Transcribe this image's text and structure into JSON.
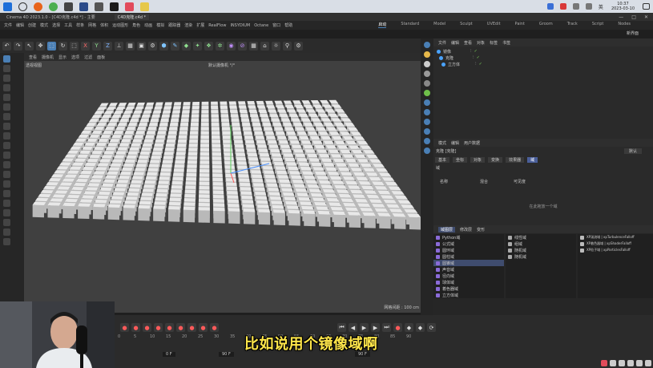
{
  "taskbar": {
    "search_icon": "search-icon",
    "clock_time": "10:37",
    "clock_date": "2023-03-10",
    "tray_lang": "英"
  },
  "window": {
    "title": "Cinema 4D 2023.1.0 - [C4D克隆.c4d *] - 主要",
    "doc_tab": "C4D克隆.c4d *",
    "menu": [
      "文件",
      "编辑",
      "创建",
      "模式",
      "选择",
      "工具",
      "样条",
      "网格",
      "体积",
      "运动图形",
      "角色",
      "动画",
      "模拟",
      "跟踪器",
      "渲染",
      "扩展",
      "RealFlow",
      "INSYDIUM",
      "Octane",
      "窗口",
      "帮助"
    ],
    "layouts": [
      "启动",
      "Standard",
      "Model",
      "Sculpt",
      "UVEdit",
      "Paint",
      "Groom",
      "Track",
      "Script",
      "Nodes"
    ],
    "layout_active": "启动",
    "new_layout": "新界面"
  },
  "viewport": {
    "menu": [
      "查看",
      "摄像机",
      "显示",
      "选项",
      "过滤",
      "面板"
    ],
    "label": "透视视图",
    "camera": "默认摄像机 °/°",
    "grid_info": "网格间距 : 100 cm"
  },
  "object_manager": {
    "menu": [
      "文件",
      "编辑",
      "查看",
      "对象",
      "标签",
      "书签"
    ],
    "items": [
      {
        "name": "镜像",
        "color": "#4aa3ff"
      },
      {
        "name": "克隆",
        "color": "#4aa3ff"
      },
      {
        "name": "立方体",
        "color": "#4aa3ff"
      }
    ]
  },
  "attribute_manager": {
    "menu": [
      "模式",
      "编辑",
      "用户数据"
    ],
    "header": "克隆 [克隆]",
    "preset": "默认",
    "tabs": [
      "基本",
      "坐标",
      "对象",
      "变换",
      "效果器"
    ],
    "active_tab": "域",
    "section": "域",
    "col_name": "名称",
    "col_mix": "混合",
    "col_visible": "可见度",
    "drop_hint": "在此拖放一个域"
  },
  "field_menu": {
    "tabs": [
      "域图层",
      "修改层",
      "变形"
    ],
    "col1": [
      "Python域",
      "公式域",
      "圆环域",
      "圆柱域",
      "圆锥域",
      "声音域",
      "径向域",
      "球体域",
      "着色器域",
      "立方体域"
    ],
    "col1_highlight": "圆锥域",
    "col2": [
      "线性域",
      "组域",
      "随机域",
      "随机域"
    ],
    "col3": [
      "XP湍流域 | xpTurbulenceFalloff",
      "XP着色器域 | xpShaderFalloff",
      "XP粒子域 | xpParticlesFalloff"
    ]
  },
  "timeline": {
    "ticks": [
      "0",
      "5",
      "10",
      "15",
      "20",
      "25",
      "30",
      "35",
      "40",
      "45",
      "50",
      "55",
      "60",
      "65",
      "70",
      "75",
      "80",
      "85",
      "90"
    ],
    "start_frame": "0 F",
    "end_frame": "90 F",
    "current_frame": "0 F"
  },
  "subtitle": "比如说用个镜像域啊",
  "colors": {
    "accent_blue": "#4a7fb5",
    "highlight": "#3f4c6e",
    "subtitle_yellow": "#ffe64a",
    "cube_top": "#e8e8e8",
    "cube_side": "#b9b9b9"
  }
}
